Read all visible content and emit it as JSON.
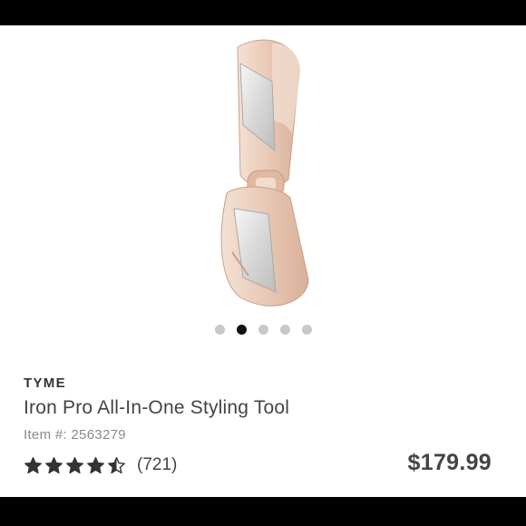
{
  "product": {
    "brand": "TYME",
    "title": "Iron Pro All-In-One Styling Tool",
    "item_number": "Item #: 2563279",
    "rating": 4.5,
    "rating_max": 5,
    "review_count": "(721)",
    "price": "$179.99"
  },
  "carousel": {
    "total": 5,
    "active_index": 1
  },
  "colors": {
    "background": "#ffffff",
    "status_bar": "#000000",
    "tool_rose_gold": "#e9cdbb",
    "text_dark": "#444444",
    "text_muted": "#8a8a8a",
    "dot_active": "#111111",
    "dot_inactive": "#c8c8c8"
  },
  "icons": {
    "star_full": "star-icon",
    "star_half": "half-star-icon"
  }
}
